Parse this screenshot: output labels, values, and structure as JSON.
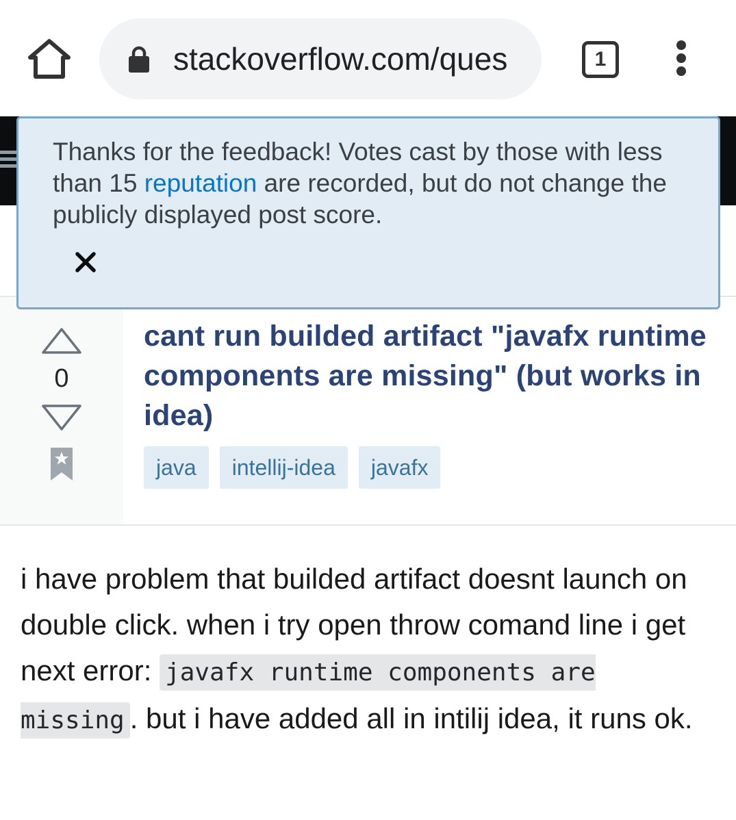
{
  "browser": {
    "url": "stackoverflow.com/ques",
    "tab_count": "1",
    "icons": {
      "home": "home-icon",
      "lock": "lock-icon",
      "menu": "more-vert-icon"
    }
  },
  "notice": {
    "text_before": "Thanks for the feedback! Votes cast by those with less than 15 ",
    "link": "reputation",
    "text_after": " are recorded, but do not change the publicly displayed post score.",
    "close_glyph": "×"
  },
  "question": {
    "vote_count": "0",
    "title": "cant run builded artifact \"javafx runtime components are missing\" (but works in idea)",
    "tags": [
      "java",
      "intellij-idea",
      "javafx"
    ],
    "body_before": "i have problem that builded artifact doesnt launch on double click. when i try open throw comand line i get next error: ",
    "body_code": "javafx runtime components are missing",
    "body_after": ". but i have added all in intilij idea, it runs ok."
  },
  "colors": {
    "title": "#2c4377",
    "tag_bg": "#e1ecf4",
    "tag_text": "#39739d",
    "notice_bg": "#e1ecf4",
    "notice_border": "#7aa7c7",
    "link": "#0a75c2",
    "header_bg": "#0c0d0e"
  }
}
